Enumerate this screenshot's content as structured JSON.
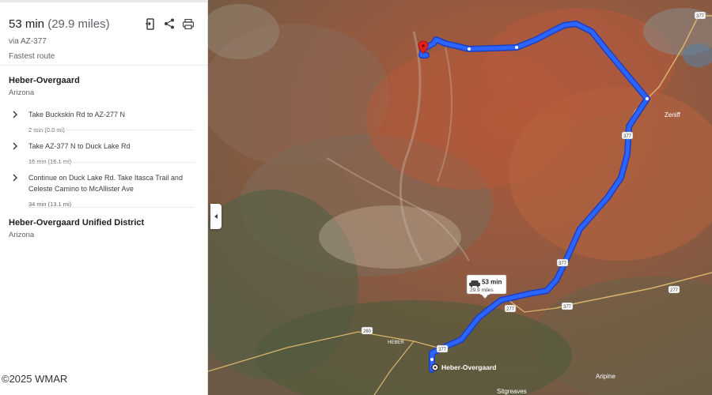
{
  "route": {
    "time": "53 min",
    "distance": "(29.9 miles)",
    "via": "via AZ-377",
    "note": "Fastest route"
  },
  "tools": [
    {
      "name": "send-to-phone-icon"
    },
    {
      "name": "share-icon"
    },
    {
      "name": "print-icon"
    }
  ],
  "origin": {
    "name": "Heber-Overgaard",
    "state": "Arizona"
  },
  "steps": [
    {
      "text": "Take Buckskin Rd to AZ-277 N",
      "meta": "2 min (0.8 mi)"
    },
    {
      "text": "Take AZ-377 N to Duck Lake Rd",
      "meta": "16 min (16.1 mi)"
    },
    {
      "text": "Continue on Duck Lake Rd. Take Itasca Trail and Celeste Camino to McAllister Ave",
      "meta": "34 min (13.1 mi)"
    }
  ],
  "destination": {
    "name": "Heber-Overgaard Unified District",
    "state": "Arizona"
  },
  "copyright": "©2025 WMAR",
  "map": {
    "route_color": "#1a53ff",
    "callout_time": "53 min",
    "callout_distance": "29.9 miles",
    "origin_label": "Heber-Overgaard",
    "town_heber": "HEBER",
    "town_zeniff": "Zeniff",
    "town_aripine": "Aripine",
    "town_sitgreaves": "Sitgreaves",
    "shields": [
      "377",
      "377",
      "377",
      "377",
      "377",
      "277",
      "277",
      "260"
    ]
  }
}
